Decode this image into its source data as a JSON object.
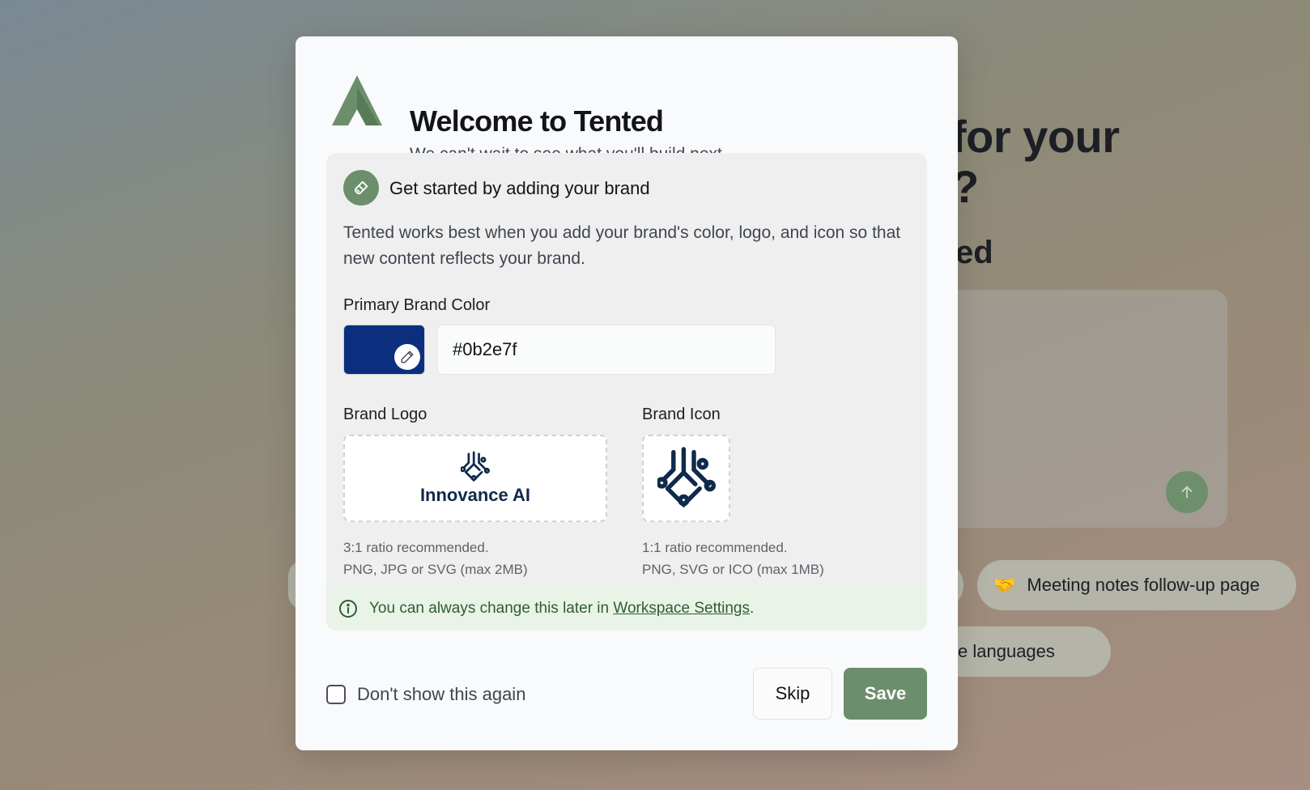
{
  "background": {
    "heading_line1": "for your",
    "heading_line2": "?",
    "subheading": "ed",
    "chips": [
      {
        "emoji": "🤝",
        "label": "Meeting notes follow-up page"
      },
      {
        "label": "ltiple languages"
      }
    ]
  },
  "modal": {
    "title": "Welcome to Tented",
    "subtitle": "We can't wait to see what you'll build next",
    "panel": {
      "heading": "Get started by adding your brand",
      "description": "Tented works best when you add your brand's color, logo, and icon so that new content reflects your brand.",
      "color_label": "Primary Brand Color",
      "color_value": "#0b2e7f",
      "logo_label": "Brand Logo",
      "logo_preview_text": "Innovance AI",
      "logo_hint_1": "3:1 ratio recommended.",
      "logo_hint_2": "PNG, JPG or SVG (max 2MB)",
      "icon_label": "Brand Icon",
      "icon_hint_1": "1:1 ratio recommended.",
      "icon_hint_2": "PNG, SVG or ICO (max 1MB)",
      "info_prefix": "You can always change this later in ",
      "info_link": "Workspace Settings",
      "info_suffix": "."
    },
    "footer": {
      "dont_show_label": "Don't show this again",
      "skip_label": "Skip",
      "save_label": "Save"
    }
  },
  "colors": {
    "accent_green": "#6b8f6a",
    "brand_navy": "#0b2e7f",
    "logo_navy": "#0f2a4a"
  },
  "icons": [
    "tented-logo",
    "brush-icon",
    "pencil-icon",
    "circuit-icon",
    "info-icon",
    "arrow-up-icon"
  ]
}
